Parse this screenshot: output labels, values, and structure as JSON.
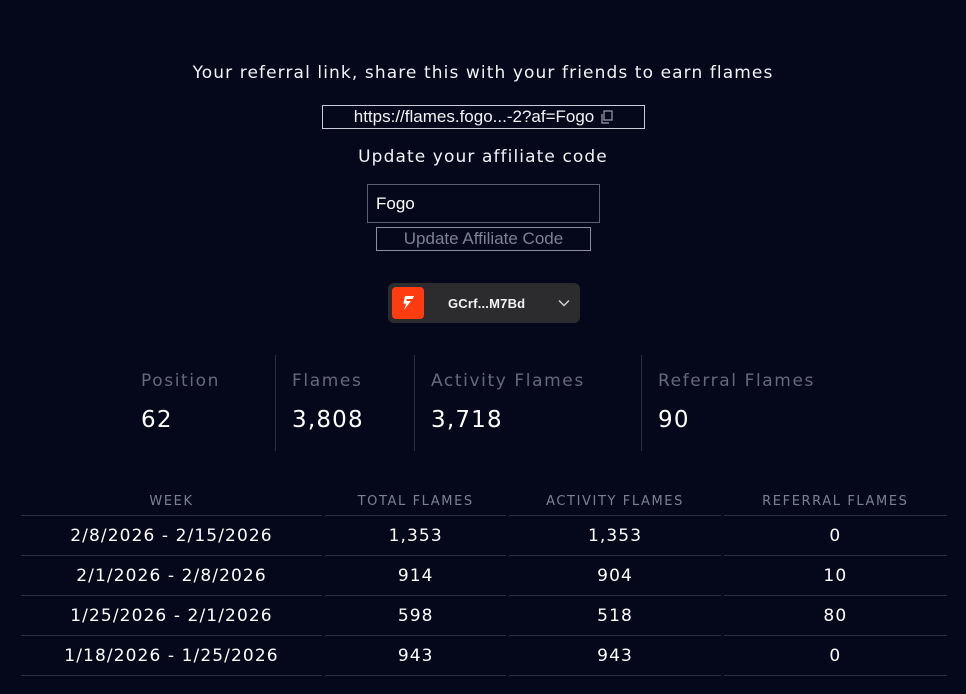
{
  "referral": {
    "heading": "Your referral link, share this with your friends to earn flames",
    "link": "https://flames.fogo...-2?af=Fogo",
    "copy_icon": "copy-icon"
  },
  "affiliate": {
    "heading": "Update your affiliate code",
    "code_value": "Fogo",
    "update_label": "Update Affiliate Code"
  },
  "wallet": {
    "address": "GCrf...M7Bd",
    "logo_icon": "fogo-flame-logo",
    "chevron_icon": "chevron-down-icon",
    "logo_color": "#ff3b10"
  },
  "stats": {
    "position_label": "Position",
    "position_value": "62",
    "flames_label": "Flames",
    "flames_value": "3,808",
    "activity_label": "Activity Flames",
    "activity_value": "3,718",
    "referral_label": "Referral Flames",
    "referral_value": "90"
  },
  "table": {
    "columns": [
      "WEEK",
      "TOTAL FLAMES",
      "ACTIVITY FLAMES",
      "REFERRAL FLAMES"
    ],
    "rows": [
      [
        "2/8/2026 - 2/15/2026",
        "1,353",
        "1,353",
        "0"
      ],
      [
        "2/1/2026 - 2/8/2026",
        "914",
        "904",
        "10"
      ],
      [
        "1/25/2026 - 2/1/2026",
        "598",
        "518",
        "80"
      ],
      [
        "1/18/2026 - 1/25/2026",
        "943",
        "943",
        "0"
      ]
    ]
  }
}
